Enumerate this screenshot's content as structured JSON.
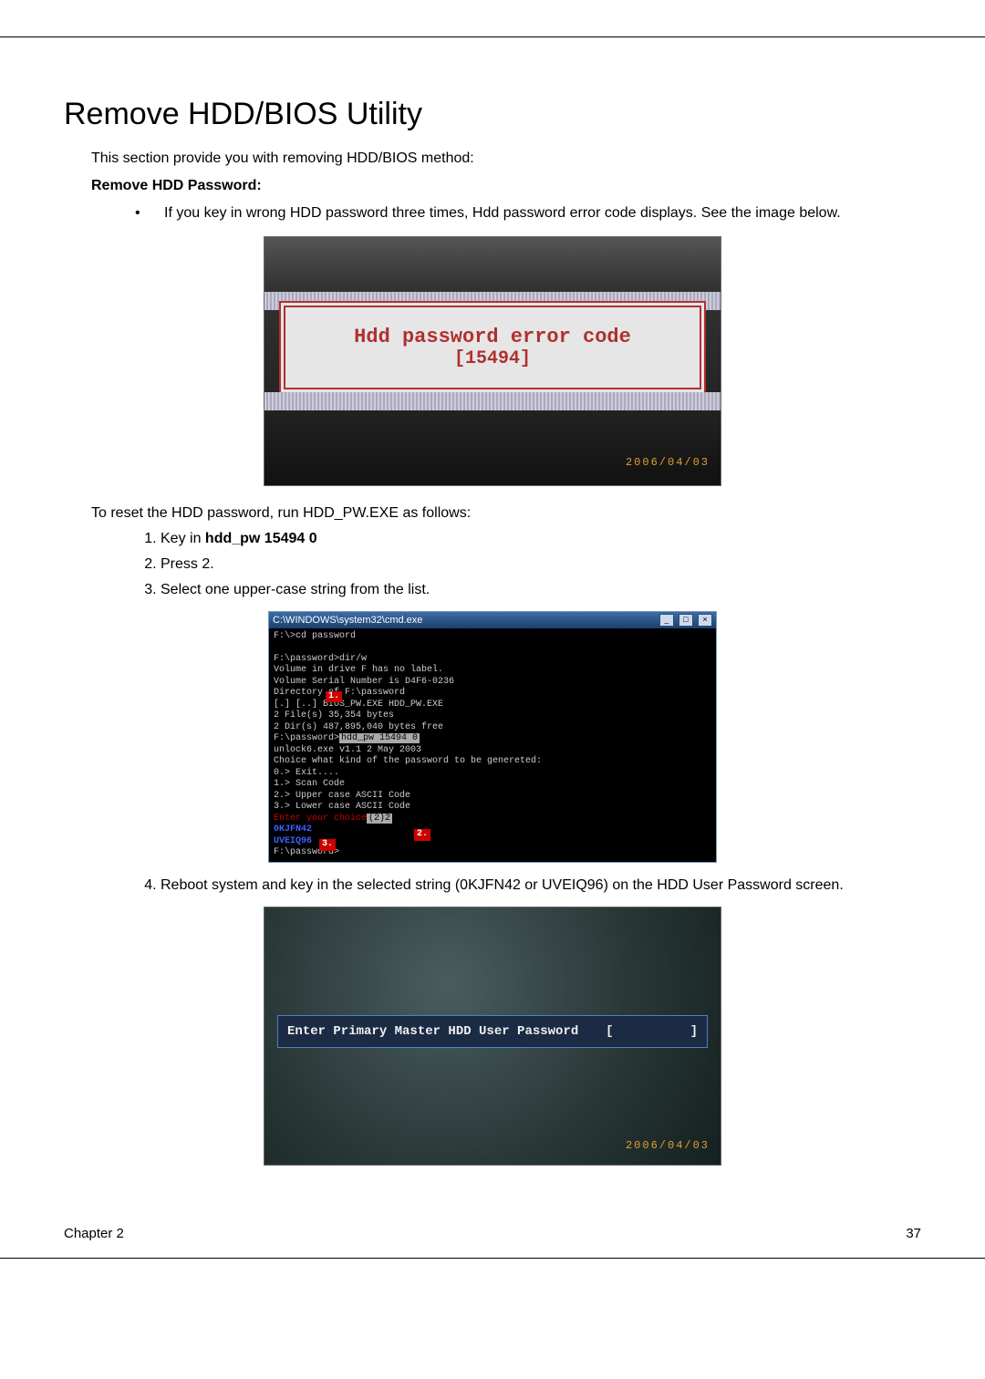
{
  "heading": "Remove HDD/BIOS Utility",
  "intro": "This section provide you with removing HDD/BIOS method:",
  "subhead": "Remove HDD Password:",
  "bullet1": "If you key in wrong HDD password three times, Hdd password error code displays. See the image below.",
  "error_screen": {
    "line1": "Hdd password error code",
    "line2": "[15494]",
    "date": "2006/04/03"
  },
  "reset_intro": "To reset the HDD password, run HDD_PW.EXE as follows:",
  "steps": {
    "s1_pre": "Key in ",
    "s1_bold": "hdd_pw 15494 0",
    "s2": "Press 2.",
    "s3": "Select one upper-case string from the list.",
    "s4": "Reboot system and key in the selected string (0KJFN42 or UVEIQ96) on the HDD User Password screen."
  },
  "cmd": {
    "title": "C:\\WINDOWS\\system32\\cmd.exe",
    "l1": "F:\\>cd password",
    "l2": "F:\\password>dir/w",
    "l3": " Volume in drive F has no label.",
    "l4": " Volume Serial Number is D4F6-0236",
    "l5": "",
    "l6": " Directory of F:\\password",
    "l7": "",
    "l8": "[.]            [..]           BIOS_PW.EXE   HDD_PW.EXE",
    "l9": "              2 File(s)         35,354 bytes",
    "l10": "              2 Dir(s)  487,895,040 bytes free",
    "l11": "",
    "l12_a": "F:\\password>",
    "l12_b": "hdd_pw 15494 0",
    "l13": "unlock6.exe   v1.1   2 May 2003",
    "l14": "",
    "l15": "Choice what kind of the password to be genereted:",
    "l16": "0.> Exit....",
    "l17": "1.> Scan Code",
    "l18": "2.> Upper case ASCII Code",
    "l19": "3.> Lower case ASCII Code",
    "l20_a": "Enter your choice",
    "l20_b": "(2)2",
    "l21": "0KJFN42",
    "l22": "UVEIQ96",
    "l23": "",
    "l24": "F:\\password>"
  },
  "pw_screen": {
    "prompt": "Enter Primary Master HDD User Password",
    "bracket_l": "[",
    "bracket_r": "]",
    "date": "2006/04/03"
  },
  "footer_left": "Chapter 2",
  "footer_right": "37"
}
